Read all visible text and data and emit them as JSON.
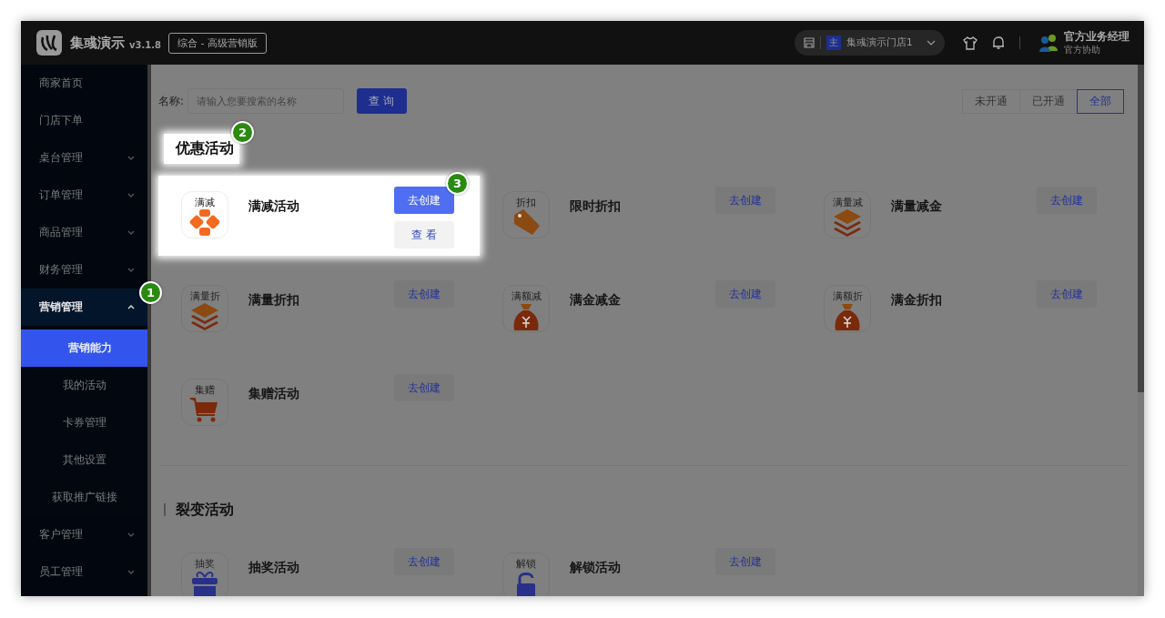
{
  "header": {
    "app_name": "集彧演示",
    "version": "v3.1.8",
    "edition": "综合 - 高级营销版",
    "store": {
      "badge": "主",
      "name": "集彧演示门店1"
    },
    "user": {
      "name": "官方业务经理",
      "role": "官方协助"
    }
  },
  "sidebar": {
    "items": [
      {
        "label": "商家首页"
      },
      {
        "label": "门店下单"
      },
      {
        "label": "桌台管理",
        "expanded": false
      },
      {
        "label": "订单管理",
        "expanded": false
      },
      {
        "label": "商品管理",
        "expanded": false
      },
      {
        "label": "财务管理",
        "expanded": false
      },
      {
        "label": "营销管理",
        "expanded": true,
        "callout": "1",
        "children": [
          {
            "label": "营销能力",
            "selected": true
          },
          {
            "label": "我的活动",
            "selected": false
          },
          {
            "label": "卡券管理",
            "selected": false
          },
          {
            "label": "其他设置",
            "selected": false
          },
          {
            "label": "获取推广链接",
            "selected": false
          }
        ]
      },
      {
        "label": "客户管理",
        "expanded": false
      },
      {
        "label": "员工管理",
        "expanded": false
      }
    ]
  },
  "search": {
    "label": "名称:",
    "placeholder": "请输入您要搜索的名称",
    "button": "查 询"
  },
  "filters": [
    {
      "label": "未开通",
      "selected": false
    },
    {
      "label": "已开通",
      "selected": false
    },
    {
      "label": "全部",
      "selected": true
    }
  ],
  "sections": [
    {
      "title": "优惠活动",
      "highlighted": true,
      "callout": "2",
      "activities": [
        {
          "icon_label": "满减",
          "kind": "blocks",
          "name": "满减活动",
          "highlighted": true,
          "buttons": [
            {
              "label": "去创建",
              "kind": "primary",
              "callout": "3"
            },
            {
              "label": "查 看",
              "kind": "plain"
            }
          ]
        },
        {
          "icon_label": "折扣",
          "kind": "tag",
          "name": "限时折扣",
          "highlighted": false,
          "buttons": [
            {
              "label": "去创建",
              "kind": "plain"
            }
          ]
        },
        {
          "icon_label": "满量减",
          "kind": "layers",
          "name": "满量减金",
          "highlighted": false,
          "buttons": [
            {
              "label": "去创建",
              "kind": "plain"
            }
          ]
        },
        {
          "icon_label": "满量折",
          "kind": "layers",
          "name": "满量折扣",
          "highlighted": false,
          "buttons": [
            {
              "label": "去创建",
              "kind": "plain"
            }
          ]
        },
        {
          "icon_label": "满额减",
          "kind": "moneybag",
          "name": "满金减金",
          "highlighted": false,
          "buttons": [
            {
              "label": "去创建",
              "kind": "plain"
            }
          ]
        },
        {
          "icon_label": "满额折",
          "kind": "moneybag",
          "name": "满金折扣",
          "highlighted": false,
          "buttons": [
            {
              "label": "去创建",
              "kind": "plain"
            }
          ]
        },
        {
          "icon_label": "集赠",
          "kind": "cart",
          "name": "集赠活动",
          "highlighted": false,
          "buttons": [
            {
              "label": "去创建",
              "kind": "plain"
            }
          ]
        }
      ]
    },
    {
      "title": "裂变活动",
      "highlighted": false,
      "activities": [
        {
          "icon_label": "抽奖",
          "kind": "gift",
          "name": "抽奖活动",
          "highlighted": false,
          "buttons": [
            {
              "label": "去创建",
              "kind": "plain"
            }
          ]
        },
        {
          "icon_label": "解锁",
          "kind": "lock",
          "name": "解锁活动",
          "highlighted": false,
          "buttons": [
            {
              "label": "去创建",
              "kind": "plain"
            }
          ]
        }
      ]
    }
  ]
}
